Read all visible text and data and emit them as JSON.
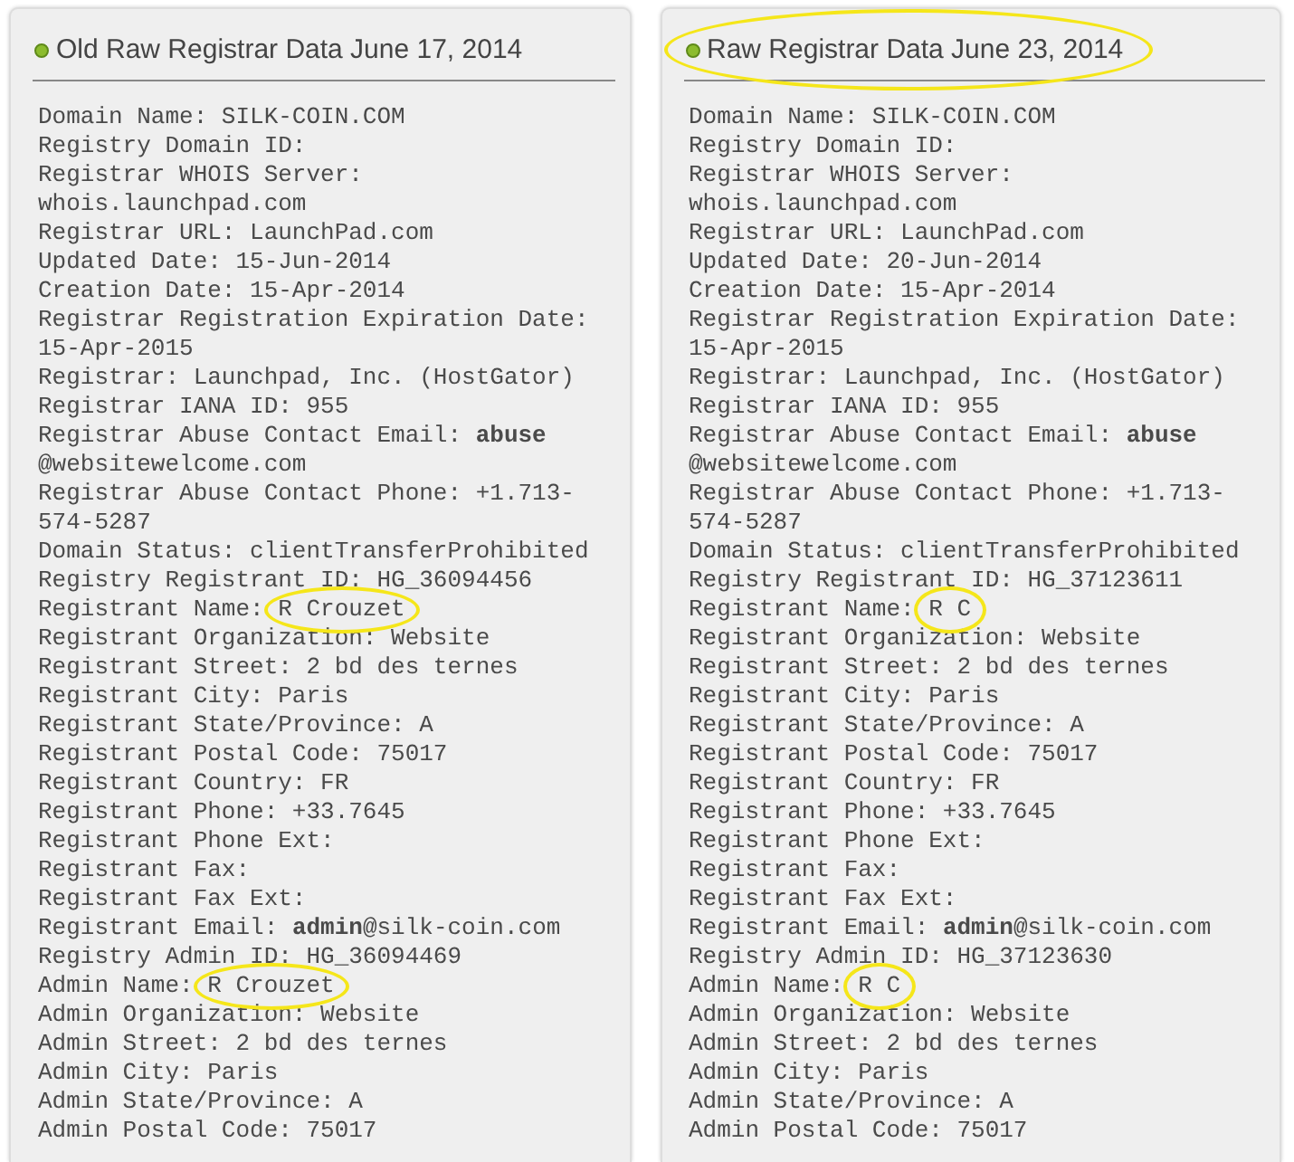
{
  "panels": [
    {
      "title": "Old Raw Registrar Data June 17, 2014",
      "title_circled": false,
      "lines": [
        {
          "text": "Domain Name: SILK-COIN.COM"
        },
        {
          "text": "Registry Domain ID:"
        },
        {
          "text": "Registrar WHOIS Server:"
        },
        {
          "text": "whois.launchpad.com"
        },
        {
          "text": "Registrar URL: LaunchPad.com"
        },
        {
          "text": "Updated Date: 15-Jun-2014"
        },
        {
          "text": "Creation Date: 15-Apr-2014"
        },
        {
          "text": "Registrar Registration Expiration Date:"
        },
        {
          "text": "15-Apr-2015"
        },
        {
          "text": "Registrar: Launchpad, Inc. (HostGator)"
        },
        {
          "text": "Registrar IANA ID: 955"
        },
        {
          "text": "Registrar Abuse Contact Email: **abuse**"
        },
        {
          "text": "@websitewelcome.com"
        },
        {
          "text": "Registrar Abuse Contact Phone: +1.713-"
        },
        {
          "text": "574-5287"
        },
        {
          "text": "Domain Status: clientTransferProhibited"
        },
        {
          "text": "Registry Registrant ID: HG_36094456"
        },
        {
          "text": "Registrant Name:",
          "circled": "R Crouzet"
        },
        {
          "text": "Registrant Organization: Website"
        },
        {
          "text": "Registrant Street: 2 bd des ternes"
        },
        {
          "text": "Registrant City: Paris"
        },
        {
          "text": "Registrant State/Province: A"
        },
        {
          "text": "Registrant Postal Code: 75017"
        },
        {
          "text": "Registrant Country: FR"
        },
        {
          "text": "Registrant Phone: +33.7645"
        },
        {
          "text": "Registrant Phone Ext:"
        },
        {
          "text": "Registrant Fax:"
        },
        {
          "text": "Registrant Fax Ext:"
        },
        {
          "text": "Registrant Email: **admin**@silk-coin.com"
        },
        {
          "text": "Registry Admin ID: HG_36094469"
        },
        {
          "text": "Admin Name:",
          "circled": "R Crouzet"
        },
        {
          "text": "Admin Organization: Website"
        },
        {
          "text": "Admin Street: 2 bd des ternes"
        },
        {
          "text": "Admin City: Paris"
        },
        {
          "text": "Admin State/Province: A"
        },
        {
          "text": "Admin Postal Code: 75017"
        }
      ]
    },
    {
      "title": "Raw Registrar Data June 23, 2014",
      "title_circled": true,
      "lines": [
        {
          "text": "Domain Name: SILK-COIN.COM"
        },
        {
          "text": "Registry Domain ID:"
        },
        {
          "text": "Registrar WHOIS Server:"
        },
        {
          "text": "whois.launchpad.com"
        },
        {
          "text": "Registrar URL: LaunchPad.com"
        },
        {
          "text": "Updated Date: 20-Jun-2014"
        },
        {
          "text": "Creation Date: 15-Apr-2014"
        },
        {
          "text": "Registrar Registration Expiration Date:"
        },
        {
          "text": "15-Apr-2015"
        },
        {
          "text": "Registrar: Launchpad, Inc. (HostGator)"
        },
        {
          "text": "Registrar IANA ID: 955"
        },
        {
          "text": "Registrar Abuse Contact Email: **abuse**"
        },
        {
          "text": "@websitewelcome.com"
        },
        {
          "text": "Registrar Abuse Contact Phone: +1.713-"
        },
        {
          "text": "574-5287"
        },
        {
          "text": "Domain Status: clientTransferProhibited"
        },
        {
          "text": "Registry Registrant ID: HG_37123611"
        },
        {
          "text": "Registrant Name:",
          "circled": "R C"
        },
        {
          "text": "Registrant Organization: Website"
        },
        {
          "text": "Registrant Street: 2 bd des ternes"
        },
        {
          "text": "Registrant City: Paris"
        },
        {
          "text": "Registrant State/Province: A"
        },
        {
          "text": "Registrant Postal Code: 75017"
        },
        {
          "text": "Registrant Country: FR"
        },
        {
          "text": "Registrant Phone: +33.7645"
        },
        {
          "text": "Registrant Phone Ext:"
        },
        {
          "text": "Registrant Fax:"
        },
        {
          "text": "Registrant Fax Ext:"
        },
        {
          "text": "Registrant Email: **admin**@silk-coin.com"
        },
        {
          "text": "Registry Admin ID: HG_37123630"
        },
        {
          "text": "Admin Name:",
          "circled": "R C"
        },
        {
          "text": "Admin Organization: Website"
        },
        {
          "text": "Admin Street: 2 bd des ternes"
        },
        {
          "text": "Admin City: Paris"
        },
        {
          "text": "Admin State/Province: A"
        },
        {
          "text": "Admin Postal Code: 75017"
        }
      ]
    }
  ]
}
